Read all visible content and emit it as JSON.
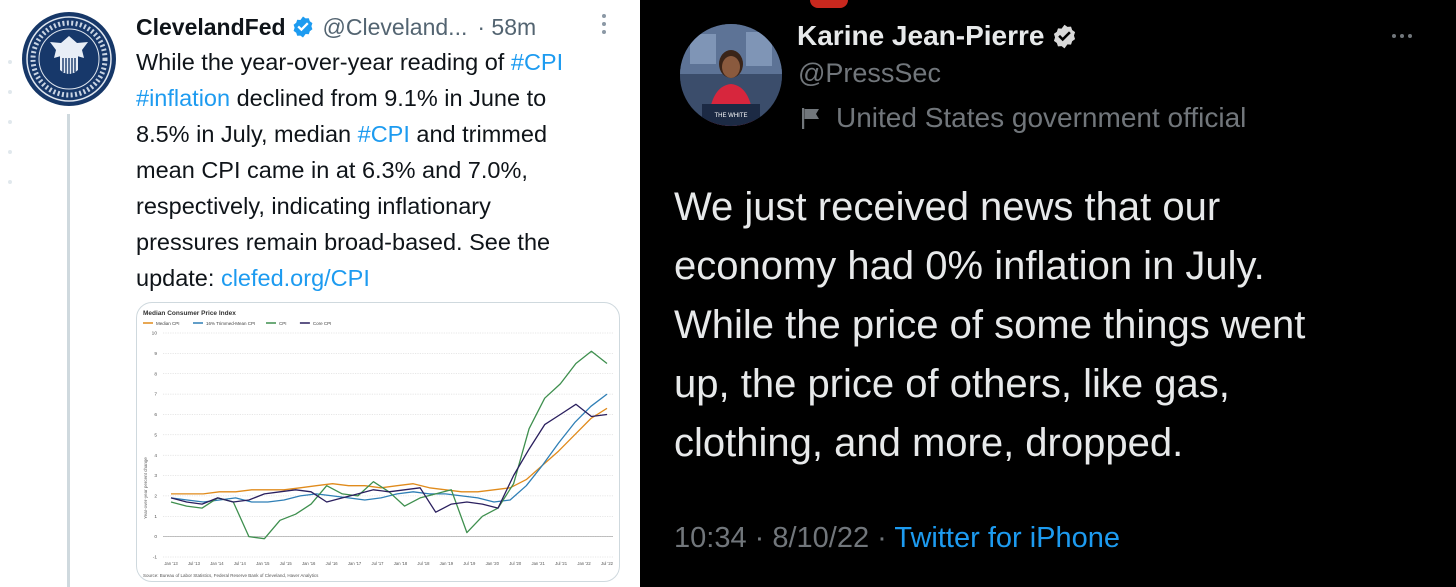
{
  "left_tweet": {
    "name": "ClevelandFed",
    "handle": "@Cleveland...",
    "time": "· 58m",
    "body_lines": [
      [
        {
          "t": "While the year-over-year reading of ",
          "link": false
        },
        {
          "t": "#CPI",
          "link": true
        }
      ],
      [
        {
          "t": "#inflation",
          "link": true
        },
        {
          "t": " declined from 9.1% in June to",
          "link": false
        }
      ],
      [
        {
          "t": "8.5% in July, median ",
          "link": false
        },
        {
          "t": "#CPI",
          "link": true
        },
        {
          "t": " and trimmed",
          "link": false
        }
      ],
      [
        {
          "t": "mean CPI came in at 6.3% and 7.0%,",
          "link": false
        }
      ],
      [
        {
          "t": "respectively, indicating inflationary",
          "link": false
        }
      ],
      [
        {
          "t": "pressures remain broad-based. See the",
          "link": false
        }
      ],
      [
        {
          "t": "update: ",
          "link": false
        },
        {
          "t": "clefed.org/CPI",
          "link": true
        }
      ]
    ],
    "seal_text": "FEDERAL RESERVE BANK OF CLEVELAND · FOURTH DISTRICT"
  },
  "chart_data": {
    "type": "line",
    "title": "Median Consumer Price Index",
    "ylabel": "Year-over-year percent change",
    "xlabel": "",
    "source": "Source: Bureau of Labor Statistics, Federal Reserve Bank of Cleveland, Haver Analytics",
    "ylim": [
      -1,
      10
    ],
    "yticks": [
      -1,
      0,
      1,
      2,
      3,
      4,
      5,
      6,
      7,
      8,
      9,
      10
    ],
    "grid": true,
    "legend_position": "top",
    "x_tick_labels": [
      "Jan '13",
      "Jul '13",
      "Jan '14",
      "Jul '14",
      "Jan '15",
      "Jul '15",
      "Jan '16",
      "Jul '16",
      "Jan '17",
      "Jul '17",
      "Jan '18",
      "Jul '18",
      "Jan '19",
      "Jul '19",
      "Jan '20",
      "Jul '20",
      "Jan '21",
      "Jul '21",
      "Jan '22",
      "Jul '22"
    ],
    "series": [
      {
        "name": "Median CPI",
        "color": "#e08b1c",
        "values": [
          2.1,
          2.1,
          2.1,
          2.2,
          2.2,
          2.3,
          2.3,
          2.3,
          2.4,
          2.5,
          2.6,
          2.5,
          2.5,
          2.4,
          2.5,
          2.6,
          2.4,
          2.3,
          2.2,
          2.2,
          2.3,
          2.4,
          2.8,
          3.5,
          4.2,
          5.0,
          5.8,
          6.3
        ]
      },
      {
        "name": "16% Trimmed-Mean CPI",
        "color": "#2f7fb6",
        "values": [
          1.9,
          1.8,
          1.7,
          1.8,
          1.9,
          1.7,
          1.7,
          1.8,
          2.0,
          2.1,
          2.0,
          1.9,
          1.8,
          1.9,
          2.1,
          2.2,
          2.1,
          2.1,
          2.0,
          1.9,
          1.7,
          1.8,
          2.5,
          3.5,
          4.6,
          5.6,
          6.4,
          7.0
        ]
      },
      {
        "name": "CPI",
        "color": "#3e8f4e",
        "values": [
          1.7,
          1.5,
          1.4,
          1.9,
          1.7,
          0.0,
          -0.1,
          0.8,
          1.1,
          1.6,
          2.5,
          2.1,
          2.0,
          2.7,
          2.2,
          1.5,
          1.9,
          2.1,
          2.3,
          0.2,
          1.0,
          1.4,
          2.6,
          5.3,
          6.8,
          7.5,
          8.5,
          9.1,
          8.5
        ]
      },
      {
        "name": "Core CPI",
        "color": "#2a1f5e",
        "values": [
          1.9,
          1.7,
          1.6,
          1.9,
          1.7,
          1.8,
          2.1,
          2.2,
          2.3,
          2.2,
          1.7,
          1.9,
          2.1,
          2.3,
          2.2,
          2.3,
          2.4,
          1.2,
          1.6,
          1.7,
          1.6,
          1.4,
          3.0,
          4.3,
          5.5,
          6.0,
          6.5,
          5.9,
          6.0
        ]
      }
    ]
  },
  "right_tweet": {
    "name": "Karine Jean-Pierre",
    "handle": "@PressSec",
    "label": "United States government official",
    "body_lines": [
      "We just received news that our",
      "economy had 0% inflation in July.",
      "While the price of some things went",
      "up, the price of others, like gas,",
      "clothing, and more, dropped."
    ],
    "timestamp": "10:34 · 8/10/22 · ",
    "source": "Twitter for iPhone",
    "podium_text": "THE WHITE"
  },
  "colors": {
    "link": "#1d9bf0",
    "verified": "#1d9bf0",
    "dark_bg": "#000000",
    "dark_text": "#e7e9ea",
    "muted": "#71767b"
  }
}
